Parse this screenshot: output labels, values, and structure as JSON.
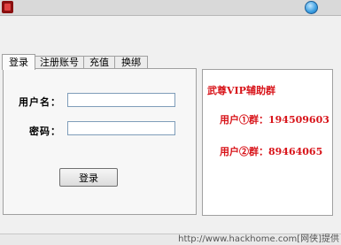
{
  "title_bar": {
    "app_icon": "game-icon",
    "close_icon": "close-orb-icon"
  },
  "tabs": [
    {
      "label": "登录",
      "active": true
    },
    {
      "label": "注册账号",
      "active": false
    },
    {
      "label": "充值",
      "active": false
    },
    {
      "label": "换绑",
      "active": false
    }
  ],
  "login_form": {
    "username_label": "用户名：",
    "username_value": "",
    "password_label": "密码：",
    "password_value": "",
    "login_button": "登录"
  },
  "info_panel": {
    "title": "武尊VIP辅助群",
    "group1": "用户①群：194509603",
    "group2": "用户②群：89464065",
    "text_color": "#d8141a"
  },
  "watermark": "http://www.hackhome.com[网侠]提供"
}
